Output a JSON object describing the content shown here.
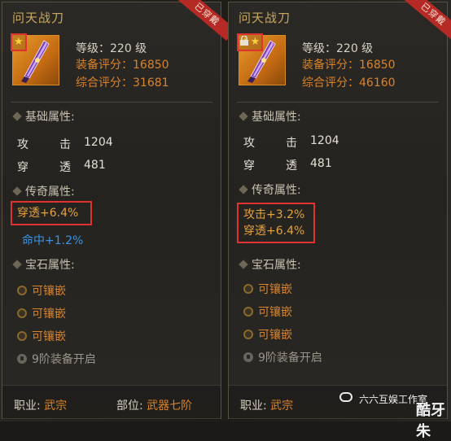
{
  "left": {
    "title": "问天战刀",
    "badge": "已穿戴",
    "stars": 1,
    "level_label": "等级：220 级",
    "equip_score": "装备评分：16850",
    "total_score": "综合评分：31681",
    "base_header": "基础属性:",
    "base": [
      {
        "name": "攻",
        "name2": "击",
        "value": "1204"
      },
      {
        "name": "穿",
        "name2": "透",
        "value": "481"
      }
    ],
    "legend_header": "传奇属性:",
    "legend_boxed": [
      "穿透+6.4%"
    ],
    "legend_extra": "命中+1.2%",
    "gem_header": "宝石属性:",
    "gems": [
      "可镶嵌",
      "可镶嵌",
      "可镶嵌"
    ],
    "unlock": "9阶装备开启",
    "footer_job_label": "职业:",
    "footer_job": "武宗",
    "footer_pos_label": "部位:",
    "footer_pos": "武器七阶"
  },
  "right": {
    "title": "问天战刀",
    "badge": "已穿戴",
    "stars": 2,
    "level_label": "等级：220 级",
    "equip_score": "装备评分：16850",
    "total_score": "综合评分：46160",
    "base_header": "基础属性:",
    "base": [
      {
        "name": "攻",
        "name2": "击",
        "value": "1204"
      },
      {
        "name": "穿",
        "name2": "透",
        "value": "481"
      }
    ],
    "legend_header": "传奇属性:",
    "legend_boxed": [
      "攻击+3.2%",
      "穿透+6.4%"
    ],
    "gem_header": "宝石属性:",
    "gems": [
      "可镶嵌",
      "可镶嵌",
      "可镶嵌"
    ],
    "unlock": "9阶装备开启",
    "footer_job_label": "职业:",
    "footer_job": "武宗"
  },
  "watermark": {
    "text": "六六互娱工作室",
    "big": "酷牙朱"
  }
}
